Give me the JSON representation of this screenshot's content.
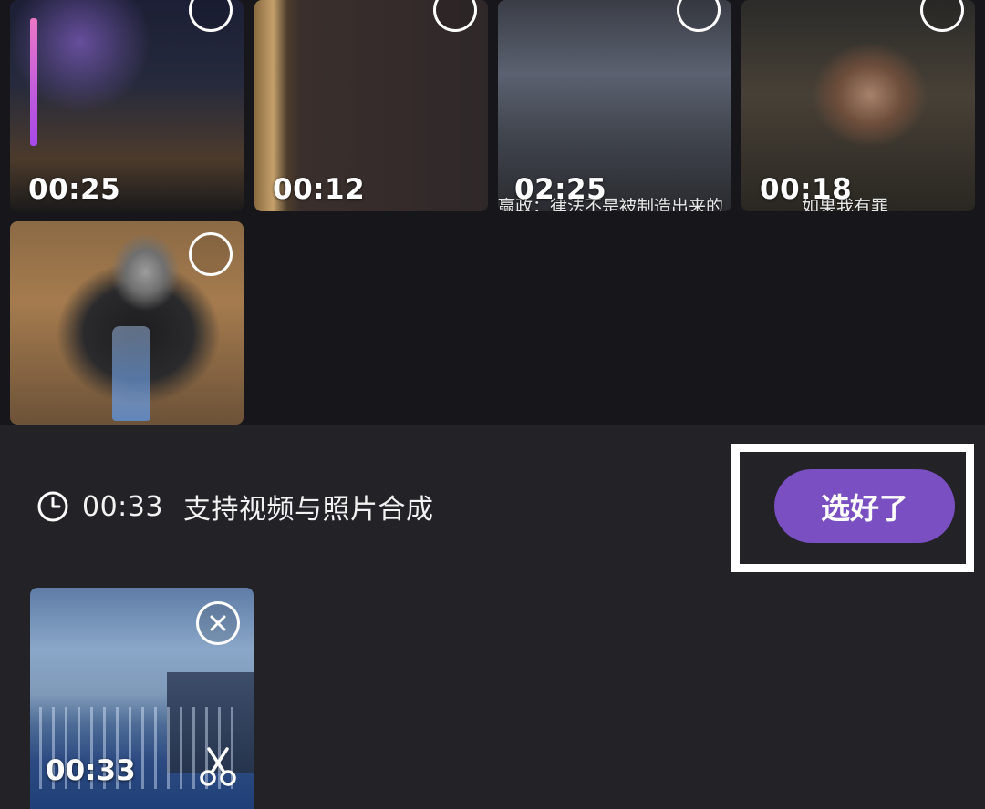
{
  "media_grid": {
    "items": [
      {
        "duration": "00:25",
        "subtitle": "",
        "selected": false
      },
      {
        "duration": "00:12",
        "subtitle": "",
        "selected": false
      },
      {
        "duration": "02:25",
        "subtitle": "赢政：律法不是被制造出来的",
        "selected": false
      },
      {
        "duration": "00:18",
        "subtitle": "如果我有罪",
        "selected": false
      },
      {
        "duration": "",
        "subtitle": "",
        "selected": false
      }
    ]
  },
  "selection_bar": {
    "total_duration": "00:33",
    "hint": "支持视频与照片合成",
    "confirm_label": "选好了"
  },
  "selected_clips": [
    {
      "duration": "00:33"
    }
  ],
  "colors": {
    "background": "#17161b",
    "panel": "#232227",
    "accent": "#7a4fc2",
    "highlight_border": "#ffffff"
  },
  "icons": {
    "clock": "clock-icon",
    "remove": "close-icon",
    "trim": "scissors-icon",
    "select": "circle-icon"
  }
}
